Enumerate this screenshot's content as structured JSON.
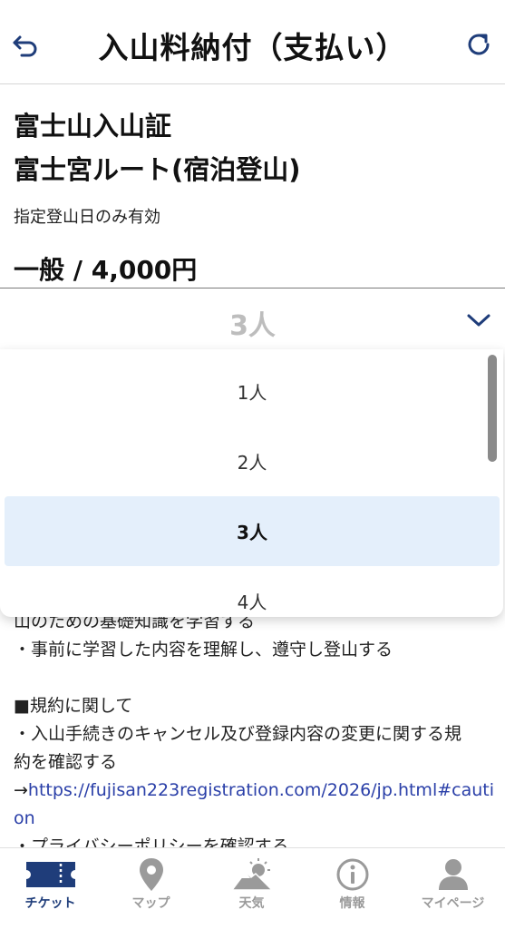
{
  "header": {
    "title": "入山料納付（支払い）"
  },
  "ticket": {
    "name_line1": "富士山入山証",
    "name_line2": "富士宮ルート(宿泊登山)",
    "valid_note": "指定登山日のみ有効",
    "price": "一般 / 4,000円"
  },
  "quantity_select": {
    "selected_value": "3人",
    "options": [
      {
        "label": "1人",
        "selected": false
      },
      {
        "label": "2人",
        "selected": false
      },
      {
        "label": "3人",
        "selected": true
      },
      {
        "label": "4人",
        "selected": false
      }
    ]
  },
  "body": {
    "line_partial": "山のための基礎知識を学習する",
    "line_understand": "・事前に学習した内容を理解し、遵守し登山する",
    "terms_heading": "■規約に関して",
    "terms_line1": "・入山手続きのキャンセル及び登録内容の変更に関する規",
    "terms_line2": "約を確認する",
    "link_arrow": "→",
    "link_line1": "https://fujisan223registration.com/2026/jp.html#cauti",
    "link_line2": "on",
    "privacy_line": "・プライバシーポリシーを確認する"
  },
  "tabs": [
    {
      "label": "チケット",
      "icon": "ticket-icon",
      "active": true
    },
    {
      "label": "マップ",
      "icon": "map-pin-icon",
      "active": false
    },
    {
      "label": "天気",
      "icon": "weather-mountain-icon",
      "active": false
    },
    {
      "label": "情報",
      "icon": "info-icon",
      "active": false
    },
    {
      "label": "マイページ",
      "icon": "person-icon",
      "active": false
    }
  ],
  "colors": {
    "accent": "#1f3d7a",
    "inactive_tab": "#9a9a9a",
    "selected_option_bg": "#e4effb",
    "link": "#2a3fa8"
  }
}
